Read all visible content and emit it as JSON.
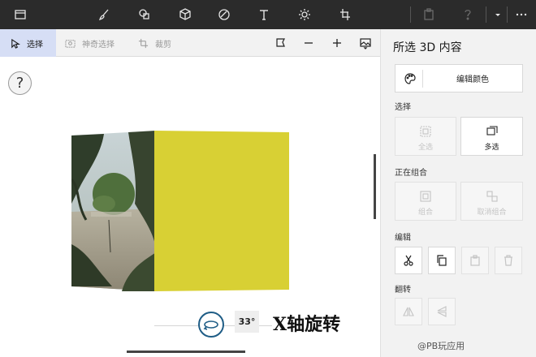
{
  "toolbar": {
    "icons": [
      "folder-icon",
      "brush-icon",
      "shapes-icon",
      "cube-icon",
      "sticker-icon",
      "text-icon",
      "effects-icon",
      "crop-icon",
      "paste-icon",
      "help-icon",
      "dropdown-icon",
      "more-icon"
    ]
  },
  "subbar": {
    "select_label": "选择",
    "magic_select_label": "神奇选择",
    "crop_label": "裁剪"
  },
  "canvas": {
    "help_label": "?",
    "rotation_angle": "33°",
    "caption": "X轴旋转",
    "cube_side_color": "#d8d034"
  },
  "panel": {
    "title": "所选 3D 内容",
    "edit_color_label": "编辑颜色",
    "section_select": "选择",
    "select_all_label": "全选",
    "multi_select_label": "多选",
    "section_group": "正在组合",
    "group_label": "组合",
    "ungroup_label": "取消组合",
    "section_edit": "编辑",
    "section_flip": "翻转"
  },
  "watermark": "@PB玩应用"
}
